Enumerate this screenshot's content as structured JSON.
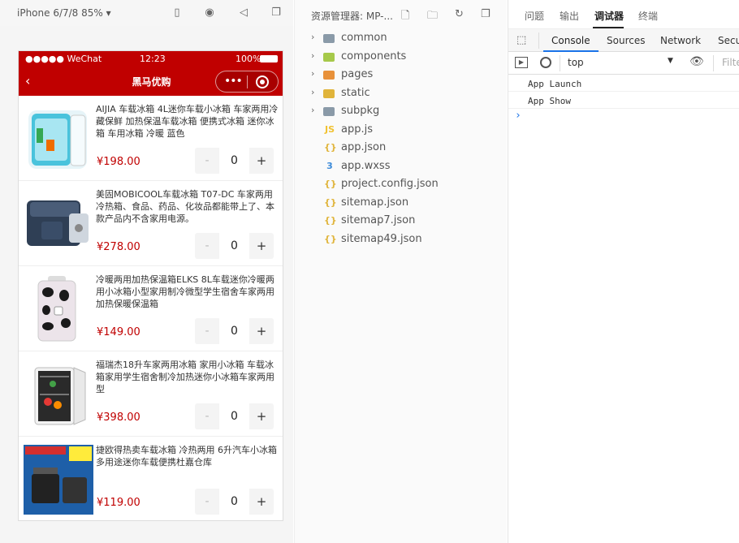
{
  "simulator": {
    "device": "iPhone 6/7/8 85% ▾",
    "status": {
      "carrier": "●●●●● WeChat",
      "time": "12:23",
      "battery": "100%"
    },
    "nav": {
      "back": "‹",
      "title": "黑马优购",
      "more": "•••"
    },
    "products": [
      {
        "name": "AIJIA 车载冰箱 4L迷你车载小冰箱 车家两用冷藏保鲜 加热保温车载冰箱 便携式冰箱 迷你冰箱 车用冰箱 冷暖 蓝色",
        "price": "¥198.00",
        "count": "0",
        "image": "cyan-mini-fridge"
      },
      {
        "name": "美固MOBICOOL车载冰箱 T07-DC 车家两用 冷热箱、食品、药品、化妆品都能带上了、本款产品内不含家用电源。",
        "price": "¥278.00",
        "count": "0",
        "image": "dark-cooler-box"
      },
      {
        "name": "冷暖两用加热保温箱ELKS 8L车载迷你冷暖两用小冰箱小型家用制冷微型学生宿舍车家两用加热保暖保温箱",
        "price": "¥149.00",
        "count": "0",
        "image": "cow-pattern-fridge"
      },
      {
        "name": "福瑞杰18升车家两用冰箱 家用小冰箱 车载冰箱家用学生宿舍制冷加热迷你小冰箱车家两用型",
        "price": "¥398.00",
        "count": "0",
        "image": "white-open-fridge"
      },
      {
        "name": "捷欧得热卖车载冰箱 冷热两用 6升汽车小冰箱 多用途迷你车载便携杜嘉仓库",
        "price": "¥119.00",
        "count": "0",
        "image": "blue-box-fridge"
      }
    ],
    "stepper": {
      "minus": "-",
      "plus": "+"
    }
  },
  "explorer": {
    "title": "资源管理器: MP-...",
    "items": [
      {
        "label": "common",
        "type": "folder",
        "color": "#8a9aa8"
      },
      {
        "label": "components",
        "type": "folder",
        "color": "#a6c94a"
      },
      {
        "label": "pages",
        "type": "folder",
        "color": "#e8913a"
      },
      {
        "label": "static",
        "type": "folder",
        "color": "#e0b43a"
      },
      {
        "label": "subpkg",
        "type": "folder",
        "color": "#8a9aa8"
      },
      {
        "label": "app.js",
        "type": "js",
        "glyph": "JS"
      },
      {
        "label": "app.json",
        "type": "json",
        "glyph": "{}"
      },
      {
        "label": "app.wxss",
        "type": "css",
        "glyph": "3"
      },
      {
        "label": "project.config.json",
        "type": "json",
        "glyph": "{}"
      },
      {
        "label": "sitemap.json",
        "type": "json",
        "glyph": "{}"
      },
      {
        "label": "sitemap7.json",
        "type": "json",
        "glyph": "{}"
      },
      {
        "label": "sitemap49.json",
        "type": "json",
        "glyph": "{}"
      }
    ]
  },
  "devtools": {
    "top_tabs": [
      "问题",
      "输出",
      "调试器",
      "终端"
    ],
    "panel_tabs": [
      "Console",
      "Sources",
      "Network",
      "Secu"
    ],
    "context": "top",
    "filter_placeholder": "Filte",
    "logs": [
      "App  Launch",
      "App  Show"
    ],
    "prompt": "›"
  },
  "colors": {
    "brand": "#c00000",
    "accent": "#1a73e8"
  }
}
